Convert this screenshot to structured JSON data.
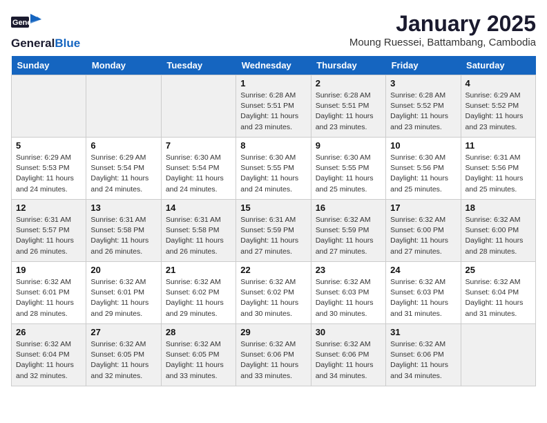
{
  "logo": {
    "general": "General",
    "blue": "Blue"
  },
  "title": "January 2025",
  "location": "Moung Ruessei, Battambang, Cambodia",
  "weekdays": [
    "Sunday",
    "Monday",
    "Tuesday",
    "Wednesday",
    "Thursday",
    "Friday",
    "Saturday"
  ],
  "weeks": [
    [
      {
        "day": "",
        "sunrise": "",
        "sunset": "",
        "daylight": ""
      },
      {
        "day": "",
        "sunrise": "",
        "sunset": "",
        "daylight": ""
      },
      {
        "day": "",
        "sunrise": "",
        "sunset": "",
        "daylight": ""
      },
      {
        "day": "1",
        "sunrise": "Sunrise: 6:28 AM",
        "sunset": "Sunset: 5:51 PM",
        "daylight": "Daylight: 11 hours and 23 minutes."
      },
      {
        "day": "2",
        "sunrise": "Sunrise: 6:28 AM",
        "sunset": "Sunset: 5:51 PM",
        "daylight": "Daylight: 11 hours and 23 minutes."
      },
      {
        "day": "3",
        "sunrise": "Sunrise: 6:28 AM",
        "sunset": "Sunset: 5:52 PM",
        "daylight": "Daylight: 11 hours and 23 minutes."
      },
      {
        "day": "4",
        "sunrise": "Sunrise: 6:29 AM",
        "sunset": "Sunset: 5:52 PM",
        "daylight": "Daylight: 11 hours and 23 minutes."
      }
    ],
    [
      {
        "day": "5",
        "sunrise": "Sunrise: 6:29 AM",
        "sunset": "Sunset: 5:53 PM",
        "daylight": "Daylight: 11 hours and 24 minutes."
      },
      {
        "day": "6",
        "sunrise": "Sunrise: 6:29 AM",
        "sunset": "Sunset: 5:54 PM",
        "daylight": "Daylight: 11 hours and 24 minutes."
      },
      {
        "day": "7",
        "sunrise": "Sunrise: 6:30 AM",
        "sunset": "Sunset: 5:54 PM",
        "daylight": "Daylight: 11 hours and 24 minutes."
      },
      {
        "day": "8",
        "sunrise": "Sunrise: 6:30 AM",
        "sunset": "Sunset: 5:55 PM",
        "daylight": "Daylight: 11 hours and 24 minutes."
      },
      {
        "day": "9",
        "sunrise": "Sunrise: 6:30 AM",
        "sunset": "Sunset: 5:55 PM",
        "daylight": "Daylight: 11 hours and 25 minutes."
      },
      {
        "day": "10",
        "sunrise": "Sunrise: 6:30 AM",
        "sunset": "Sunset: 5:56 PM",
        "daylight": "Daylight: 11 hours and 25 minutes."
      },
      {
        "day": "11",
        "sunrise": "Sunrise: 6:31 AM",
        "sunset": "Sunset: 5:56 PM",
        "daylight": "Daylight: 11 hours and 25 minutes."
      }
    ],
    [
      {
        "day": "12",
        "sunrise": "Sunrise: 6:31 AM",
        "sunset": "Sunset: 5:57 PM",
        "daylight": "Daylight: 11 hours and 26 minutes."
      },
      {
        "day": "13",
        "sunrise": "Sunrise: 6:31 AM",
        "sunset": "Sunset: 5:58 PM",
        "daylight": "Daylight: 11 hours and 26 minutes."
      },
      {
        "day": "14",
        "sunrise": "Sunrise: 6:31 AM",
        "sunset": "Sunset: 5:58 PM",
        "daylight": "Daylight: 11 hours and 26 minutes."
      },
      {
        "day": "15",
        "sunrise": "Sunrise: 6:31 AM",
        "sunset": "Sunset: 5:59 PM",
        "daylight": "Daylight: 11 hours and 27 minutes."
      },
      {
        "day": "16",
        "sunrise": "Sunrise: 6:32 AM",
        "sunset": "Sunset: 5:59 PM",
        "daylight": "Daylight: 11 hours and 27 minutes."
      },
      {
        "day": "17",
        "sunrise": "Sunrise: 6:32 AM",
        "sunset": "Sunset: 6:00 PM",
        "daylight": "Daylight: 11 hours and 27 minutes."
      },
      {
        "day": "18",
        "sunrise": "Sunrise: 6:32 AM",
        "sunset": "Sunset: 6:00 PM",
        "daylight": "Daylight: 11 hours and 28 minutes."
      }
    ],
    [
      {
        "day": "19",
        "sunrise": "Sunrise: 6:32 AM",
        "sunset": "Sunset: 6:01 PM",
        "daylight": "Daylight: 11 hours and 28 minutes."
      },
      {
        "day": "20",
        "sunrise": "Sunrise: 6:32 AM",
        "sunset": "Sunset: 6:01 PM",
        "daylight": "Daylight: 11 hours and 29 minutes."
      },
      {
        "day": "21",
        "sunrise": "Sunrise: 6:32 AM",
        "sunset": "Sunset: 6:02 PM",
        "daylight": "Daylight: 11 hours and 29 minutes."
      },
      {
        "day": "22",
        "sunrise": "Sunrise: 6:32 AM",
        "sunset": "Sunset: 6:02 PM",
        "daylight": "Daylight: 11 hours and 30 minutes."
      },
      {
        "day": "23",
        "sunrise": "Sunrise: 6:32 AM",
        "sunset": "Sunset: 6:03 PM",
        "daylight": "Daylight: 11 hours and 30 minutes."
      },
      {
        "day": "24",
        "sunrise": "Sunrise: 6:32 AM",
        "sunset": "Sunset: 6:03 PM",
        "daylight": "Daylight: 11 hours and 31 minutes."
      },
      {
        "day": "25",
        "sunrise": "Sunrise: 6:32 AM",
        "sunset": "Sunset: 6:04 PM",
        "daylight": "Daylight: 11 hours and 31 minutes."
      }
    ],
    [
      {
        "day": "26",
        "sunrise": "Sunrise: 6:32 AM",
        "sunset": "Sunset: 6:04 PM",
        "daylight": "Daylight: 11 hours and 32 minutes."
      },
      {
        "day": "27",
        "sunrise": "Sunrise: 6:32 AM",
        "sunset": "Sunset: 6:05 PM",
        "daylight": "Daylight: 11 hours and 32 minutes."
      },
      {
        "day": "28",
        "sunrise": "Sunrise: 6:32 AM",
        "sunset": "Sunset: 6:05 PM",
        "daylight": "Daylight: 11 hours and 33 minutes."
      },
      {
        "day": "29",
        "sunrise": "Sunrise: 6:32 AM",
        "sunset": "Sunset: 6:06 PM",
        "daylight": "Daylight: 11 hours and 33 minutes."
      },
      {
        "day": "30",
        "sunrise": "Sunrise: 6:32 AM",
        "sunset": "Sunset: 6:06 PM",
        "daylight": "Daylight: 11 hours and 34 minutes."
      },
      {
        "day": "31",
        "sunrise": "Sunrise: 6:32 AM",
        "sunset": "Sunset: 6:06 PM",
        "daylight": "Daylight: 11 hours and 34 minutes."
      },
      {
        "day": "",
        "sunrise": "",
        "sunset": "",
        "daylight": ""
      }
    ]
  ]
}
